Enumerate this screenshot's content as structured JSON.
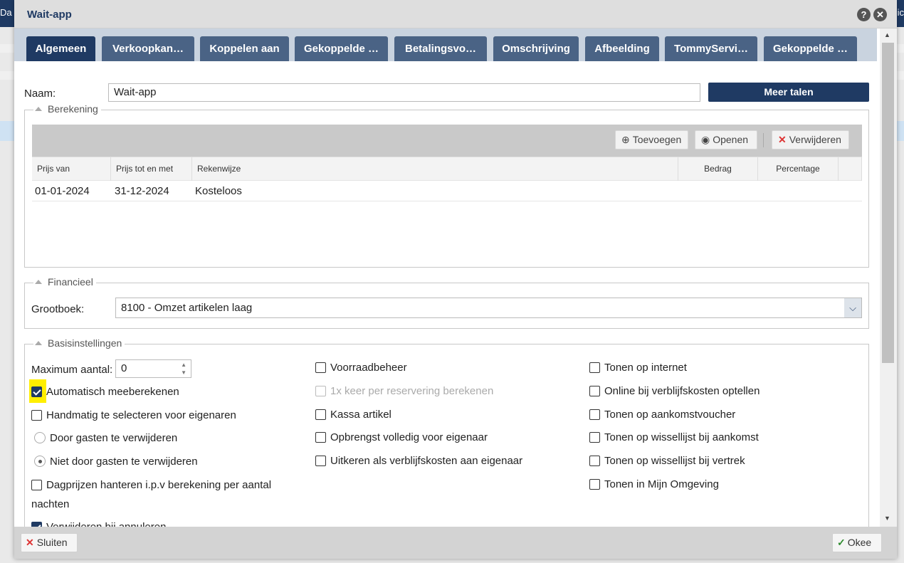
{
  "background": {
    "left_text": "Da",
    "right_text": "lic"
  },
  "window": {
    "title": "Wait-app"
  },
  "tabs": [
    {
      "label": "Algemeen"
    },
    {
      "label": "Verkoopkan…"
    },
    {
      "label": "Koppelen aan"
    },
    {
      "label": "Gekoppelde …"
    },
    {
      "label": "Betalingsvo…"
    },
    {
      "label": "Omschrijving"
    },
    {
      "label": "Afbeelding"
    },
    {
      "label": "TommyServi…"
    },
    {
      "label": "Gekoppelde …"
    }
  ],
  "naam": {
    "label": "Naam:",
    "value": "Wait-app",
    "more_languages": "Meer talen"
  },
  "berekening": {
    "legend": "Berekening",
    "toolbar": {
      "add": "Toevoegen",
      "open": "Openen",
      "delete": "Verwijderen"
    },
    "columns": [
      "Prijs van",
      "Prijs tot en met",
      "Rekenwijze",
      "Bedrag",
      "Percentage"
    ],
    "rows": [
      {
        "from": "01-01-2024",
        "to": "31-12-2024",
        "method": "Kosteloos",
        "amount": "",
        "percentage": ""
      }
    ]
  },
  "financieel": {
    "legend": "Financieel",
    "label": "Grootboek:",
    "value": "8100 - Omzet artikelen laag"
  },
  "basis": {
    "legend": "Basisinstellingen",
    "max_label": "Maximum aantal:",
    "max_value": "0",
    "col1": {
      "auto": "Automatisch meeberekenen",
      "manual": "Handmatig te selecteren voor eigenaren",
      "radio_yes": "Door gasten te verwijderen",
      "radio_no": "Niet door gasten te verwijderen",
      "daily_1": "Dagprijzen hanteren i.p.v berekening per aantal",
      "daily_2": "nachten",
      "cancel": "Verwijderen bij annuleren"
    },
    "col2": {
      "stock": "Voorraadbeheer",
      "once": "1x keer per reservering berekenen",
      "register": "Kassa artikel",
      "revenue": "Opbrengst volledig voor eigenaar",
      "payout": "Uitkeren als verblijfskosten aan eigenaar"
    },
    "col3": {
      "internet": "Tonen op internet",
      "online": "Online bij verblijfskosten optellen",
      "voucher": "Tonen op aankomstvoucher",
      "arrival": "Tonen op wissellijst bij aankomst",
      "departure": "Tonen op wissellijst bij vertrek",
      "mine": "Tonen in Mijn Omgeving"
    }
  },
  "footer": {
    "close": "Sluiten",
    "ok": "Okee"
  }
}
